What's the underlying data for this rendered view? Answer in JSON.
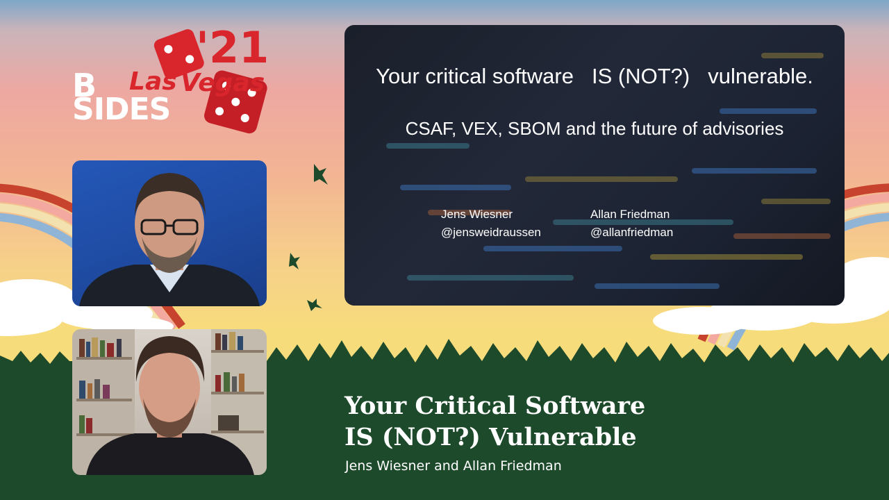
{
  "event_logo": {
    "b": "B",
    "sides": "SIDES",
    "las": "Las",
    "vegas": "Vegas",
    "year": "'21"
  },
  "colors": {
    "forest_green": "#1e4a2c",
    "logo_red": "#d9262c",
    "slide_bg": "#1c2333"
  },
  "slide": {
    "title_part1": "Your critical software",
    "title_part2": "IS (NOT?)",
    "title_part3": "vulnerable.",
    "subtitle": "CSAF, VEX, SBOM and the future of advisories",
    "speakers": [
      {
        "name": "Jens Wiesner",
        "handle": "@jensweidraussen"
      },
      {
        "name": "Allan Friedman",
        "handle": "@allanfriedman"
      }
    ]
  },
  "talk": {
    "title_line1": "Your Critical Software",
    "title_line2": "IS (NOT?) Vulnerable",
    "authors": "Jens Wiesner and Allan Friedman"
  },
  "icons": [
    "dice-icon",
    "bird-icon",
    "person-avatar-icon"
  ]
}
